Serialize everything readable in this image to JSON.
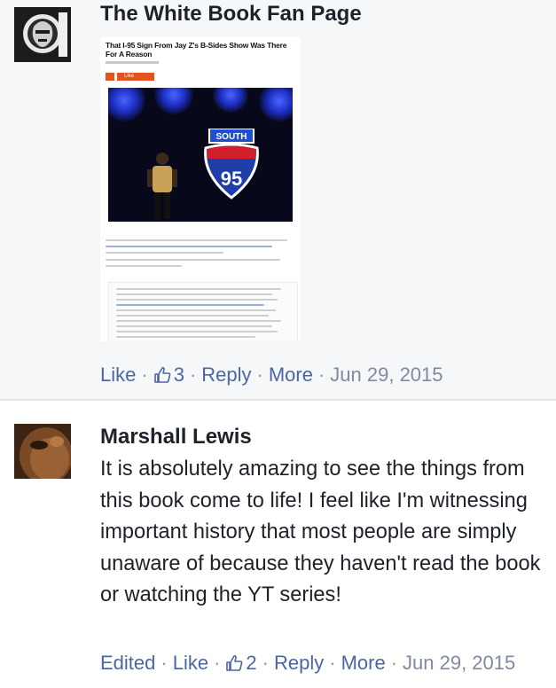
{
  "comments": [
    {
      "author": "The White Book Fan Page",
      "attachment": {
        "title": "That I-95 Sign From Jay Z's B-Sides Show Was There For A Reason",
        "share_label": "Like",
        "sign_top": "SOUTH",
        "sign_number": "95"
      },
      "actions": {
        "like": "Like",
        "reactions": "3",
        "reply": "Reply",
        "more": "More",
        "date": "Jun 29, 2015"
      }
    },
    {
      "author": "Marshall Lewis",
      "text": "It is absolutely amazing to see the things from this book come to life! I feel like I'm witnessing important history that most people are simply unaware of because they haven't read the book or watching the YT series!",
      "actions": {
        "edited": "Edited",
        "like": "Like",
        "reactions": "2",
        "reply": "Reply",
        "more": "More",
        "date": "Jun 29, 2015"
      }
    }
  ],
  "colors": {
    "link": "#4b67a1",
    "meta": "#7f89a0",
    "text": "#1d2129",
    "comment_bg": "#f6f7f9"
  },
  "icons": [
    "thumbs-up-icon"
  ]
}
